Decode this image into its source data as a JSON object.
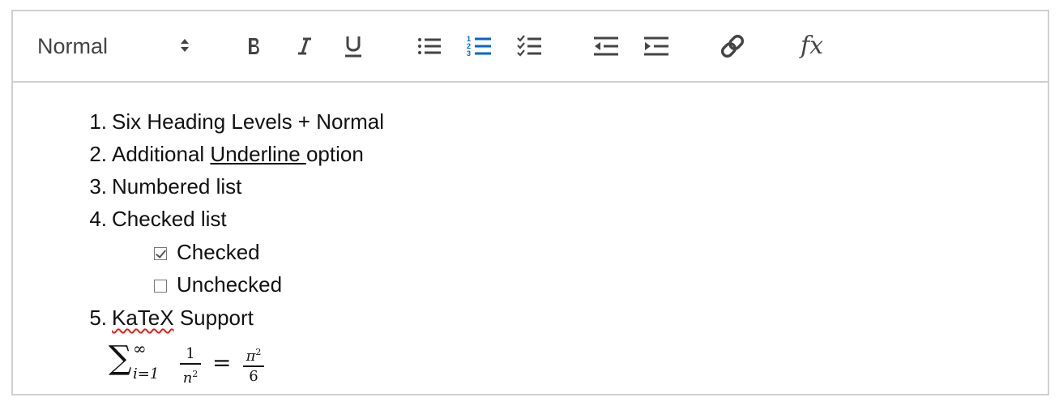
{
  "toolbar": {
    "header_select": {
      "value": "Normal"
    },
    "buttons": [
      {
        "name": "bold-button",
        "icon": "bold-icon"
      },
      {
        "name": "italic-button",
        "icon": "italic-icon"
      },
      {
        "name": "underline-button",
        "icon": "underline-icon"
      },
      {
        "name": "bullet-list-button",
        "icon": "bullet-list-icon"
      },
      {
        "name": "ordered-list-button",
        "icon": "ordered-list-icon",
        "active": true
      },
      {
        "name": "check-list-button",
        "icon": "check-list-icon"
      },
      {
        "name": "outdent-button",
        "icon": "outdent-icon"
      },
      {
        "name": "indent-button",
        "icon": "indent-icon"
      },
      {
        "name": "link-button",
        "icon": "link-icon"
      },
      {
        "name": "formula-button",
        "icon": "formula-icon"
      }
    ],
    "formula_label": "fx"
  },
  "colors": {
    "active": "#0066cc",
    "icon": "#444444",
    "border": "#cccccc",
    "spellcheck": "#e02020"
  },
  "content": {
    "list": [
      {
        "num": "1.",
        "text": "Six Heading Levels + Normal"
      },
      {
        "num": "2.",
        "pre": "Additional ",
        "underlined": "Underline ",
        "post": "option"
      },
      {
        "num": "3.",
        "text": "Numbered list"
      },
      {
        "num": "4.",
        "text": "Checked list"
      },
      {
        "num": "5.",
        "squiggle": "KaTeX",
        "post": " Support"
      }
    ],
    "checklist": [
      {
        "checked": true,
        "text": "Checked"
      },
      {
        "checked": false,
        "text": "Unchecked"
      }
    ],
    "formula": {
      "sum": "∑",
      "upper": "∞",
      "lower": "i=1",
      "frac1_num": "1",
      "frac1_den": "n",
      "frac1_den_exp": "2",
      "eq": "=",
      "frac2_num": "π",
      "frac2_num_exp": "2",
      "frac2_den": "6"
    }
  }
}
